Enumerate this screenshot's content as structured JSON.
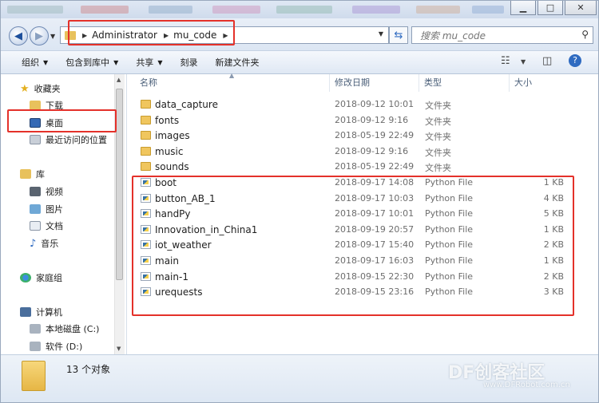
{
  "window": {
    "minimize": "▁",
    "maximize": "□",
    "close": "✕"
  },
  "nav": {
    "back_icon": "back-arrow-icon",
    "forward_icon": "forward-arrow-icon"
  },
  "address": {
    "crumbs": [
      "Administrator",
      "mu_code"
    ]
  },
  "search": {
    "placeholder": "搜索 mu_code"
  },
  "toolbar": {
    "organize": "组织",
    "include": "包含到库中",
    "share": "共享",
    "burn": "刻录",
    "new_folder": "新建文件夹"
  },
  "sidebar": {
    "favorites": "收藏夹",
    "downloads": "下载",
    "desktop": "桌面",
    "recent": "最近访问的位置",
    "libraries": "库",
    "videos": "视频",
    "pictures": "图片",
    "documents": "文档",
    "music": "音乐",
    "homegroup": "家庭组",
    "computer": "计算机",
    "drive_c": "本地磁盘 (C:)",
    "drive_d": "软件 (D:)"
  },
  "columns": {
    "name": "名称",
    "date": "修改日期",
    "type": "类型",
    "size": "大小"
  },
  "files": [
    {
      "name": "data_capture",
      "date": "2018-09-12 10:01",
      "type": "文件夹",
      "size": "",
      "kind": "folder"
    },
    {
      "name": "fonts",
      "date": "2018-09-12 9:16",
      "type": "文件夹",
      "size": "",
      "kind": "folder"
    },
    {
      "name": "images",
      "date": "2018-05-19 22:49",
      "type": "文件夹",
      "size": "",
      "kind": "folder"
    },
    {
      "name": "music",
      "date": "2018-09-12 9:16",
      "type": "文件夹",
      "size": "",
      "kind": "folder"
    },
    {
      "name": "sounds",
      "date": "2018-05-19 22:49",
      "type": "文件夹",
      "size": "",
      "kind": "folder"
    },
    {
      "name": "boot",
      "date": "2018-09-17 14:08",
      "type": "Python File",
      "size": "1 KB",
      "kind": "python"
    },
    {
      "name": "button_AB_1",
      "date": "2018-09-17 10:03",
      "type": "Python File",
      "size": "4 KB",
      "kind": "python"
    },
    {
      "name": "handPy",
      "date": "2018-09-17 10:01",
      "type": "Python File",
      "size": "5 KB",
      "kind": "python"
    },
    {
      "name": "Innovation_in_China1",
      "date": "2018-09-19 20:57",
      "type": "Python File",
      "size": "1 KB",
      "kind": "python"
    },
    {
      "name": "iot_weather",
      "date": "2018-09-17 15:40",
      "type": "Python File",
      "size": "2 KB",
      "kind": "python"
    },
    {
      "name": "main",
      "date": "2018-09-17 16:03",
      "type": "Python File",
      "size": "1 KB",
      "kind": "python"
    },
    {
      "name": "main-1",
      "date": "2018-09-15 22:30",
      "type": "Python File",
      "size": "2 KB",
      "kind": "python"
    },
    {
      "name": "urequests",
      "date": "2018-09-15 23:16",
      "type": "Python File",
      "size": "3 KB",
      "kind": "python"
    }
  ],
  "status": {
    "count": "13 个对象"
  },
  "watermark": {
    "brand": "DF创客社区",
    "url": "www.DFRobot.com.cn"
  },
  "colors": {
    "highlight": "#e4312a",
    "folder": "#f0c65e",
    "accent": "#2f6bc1"
  }
}
